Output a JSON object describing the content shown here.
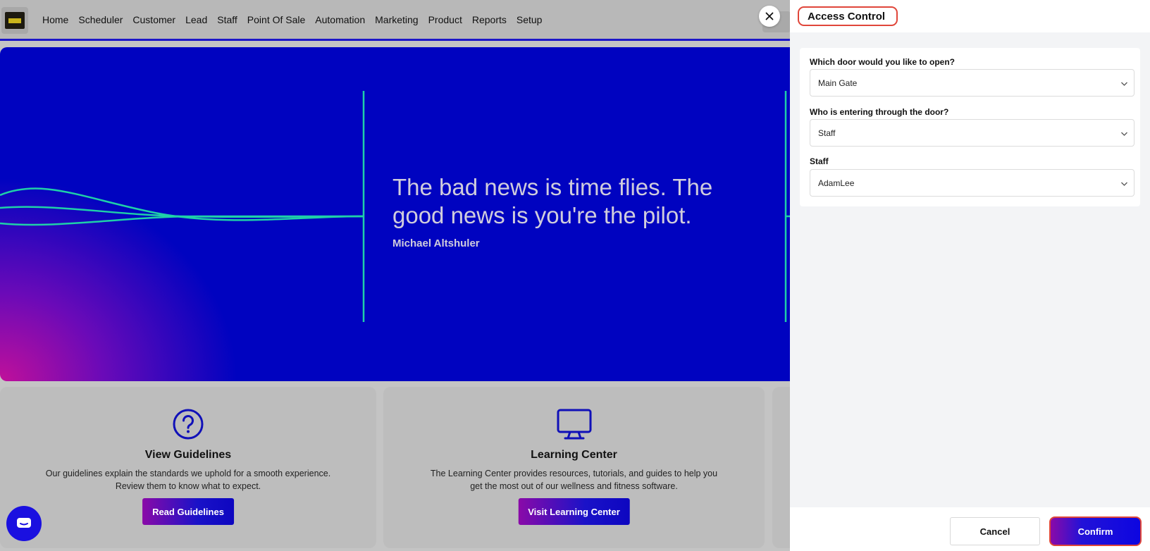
{
  "nav": {
    "items": [
      "Home",
      "Scheduler",
      "Customer",
      "Lead",
      "Staff",
      "Point Of Sale",
      "Automation",
      "Marketing",
      "Product",
      "Reports",
      "Setup"
    ]
  },
  "hero": {
    "quote": "The bad news is time flies. The good news is you're the pilot.",
    "author": "Michael Altshuler"
  },
  "cards": [
    {
      "title": "View Guidelines",
      "description": "Our guidelines explain the standards we uphold for a smooth experience. Review them to know what to expect.",
      "button": "Read Guidelines",
      "icon": "question-circle-icon"
    },
    {
      "title": "Learning Center",
      "description": "The Learning Center provides resources, tutorials, and guides to help you get the most out of our wellness and fitness software.",
      "button": "Visit Learning Center",
      "icon": "monitor-icon"
    }
  ],
  "panel": {
    "title": "Access Control",
    "fields": [
      {
        "label": "Which door would you like to open?",
        "value": "Main Gate"
      },
      {
        "label": "Who is entering through the door?",
        "value": "Staff"
      },
      {
        "label": "Staff",
        "value": "AdamLee"
      }
    ],
    "cancel_label": "Cancel",
    "confirm_label": "Confirm"
  },
  "colors": {
    "brand_blue": "#0003c0",
    "accent_magenta": "#c0109a",
    "wave_teal": "#1fd0a8",
    "highlight_red": "#e0463a"
  }
}
